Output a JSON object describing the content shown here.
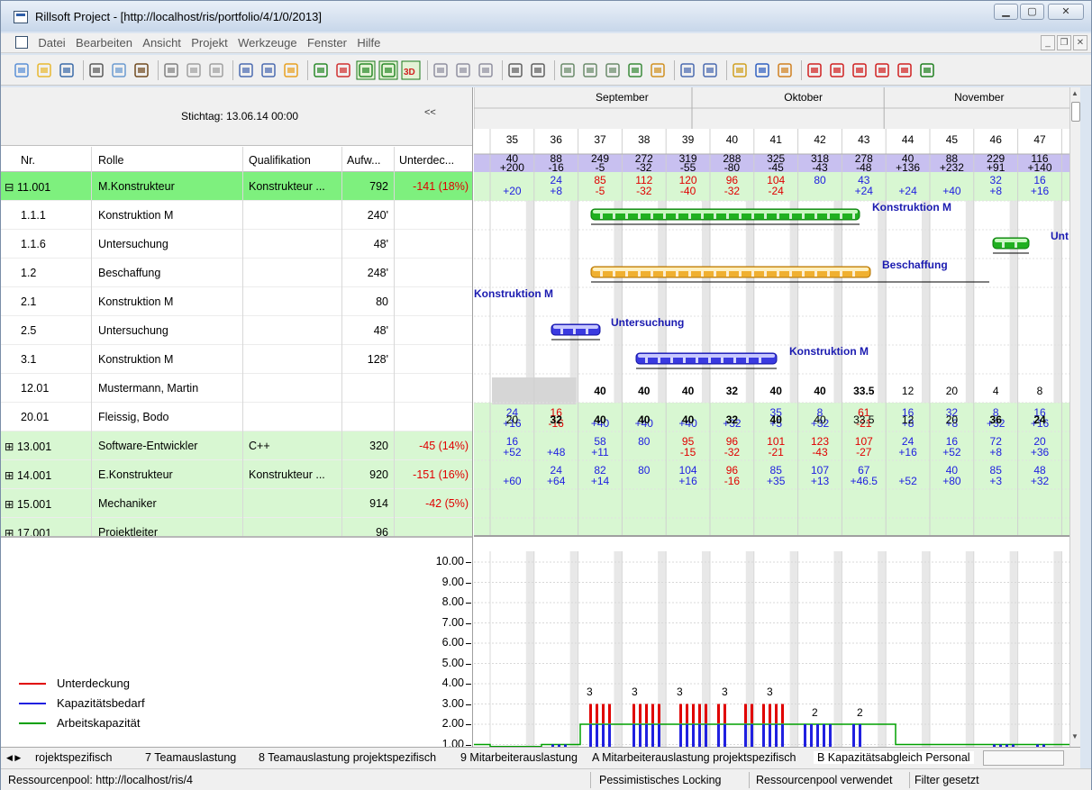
{
  "window": {
    "title": "Rillsoft Project - [http://localhost/ris/portfolio/4/1/0/2013]"
  },
  "menu": [
    "Datei",
    "Bearbeiten",
    "Ansicht",
    "Projekt",
    "Werkzeuge",
    "Fenster",
    "Hilfe"
  ],
  "toolbar": {
    "icons": [
      "new-icon",
      "open-icon",
      "save-icon",
      "print-icon",
      "print-preview-icon",
      "find-icon",
      "cut-icon",
      "copy-icon",
      "paste-icon",
      "undo-icon",
      "redo-icon",
      "star-icon",
      "link-icon",
      "unlink-icon",
      "gantt-icon",
      "table-icon",
      "3d-icon",
      "level1-icon",
      "level2-icon",
      "level3-icon",
      "move-up-icon",
      "move-down-icon",
      "resource-icon",
      "add-resource-icon",
      "remove-resource-icon",
      "assign-icon",
      "filter-icon",
      "zoom-in-icon",
      "zoom-out-icon",
      "layout1-icon",
      "layout2-icon",
      "export-icon",
      "split-icon",
      "merge-icon",
      "shift-right-icon",
      "shift-down-icon",
      "shift-left-icon",
      "milestone-icon"
    ],
    "threeD": "3D"
  },
  "left": {
    "stichtag": "Stichtag: 13.06.14 00:00",
    "collapse": "<<",
    "headers": [
      "Nr.",
      "Rolle",
      "Qualifikation",
      "Aufw...",
      "Unterdec..."
    ],
    "rows": [
      {
        "nr": "⊟ 11.001",
        "rolle": "M.Konstrukteur",
        "qual": "Konstrukteur ...",
        "aufw": "792",
        "unter": "-141 (18%)",
        "kind": "role-selected"
      },
      {
        "nr": "1.1.1",
        "rolle": "Konstruktion M",
        "qual": "",
        "aufw": "240'",
        "unter": "",
        "kind": "task"
      },
      {
        "nr": "1.1.6",
        "rolle": "Untersuchung",
        "qual": "",
        "aufw": "48'",
        "unter": "",
        "kind": "task"
      },
      {
        "nr": "1.2",
        "rolle": "Beschaffung",
        "qual": "",
        "aufw": "248'",
        "unter": "",
        "kind": "task"
      },
      {
        "nr": "2.1",
        "rolle": "Konstruktion M",
        "qual": "",
        "aufw": "80",
        "unter": "",
        "kind": "task"
      },
      {
        "nr": "2.5",
        "rolle": "Untersuchung",
        "qual": "",
        "aufw": "48'",
        "unter": "",
        "kind": "task"
      },
      {
        "nr": "3.1",
        "rolle": "Konstruktion M",
        "qual": "",
        "aufw": "128'",
        "unter": "",
        "kind": "task"
      },
      {
        "nr": "12.01",
        "rolle": "Mustermann, Martin",
        "qual": "",
        "aufw": "",
        "unter": "",
        "kind": "person"
      },
      {
        "nr": "20.01",
        "rolle": "Fleissig, Bodo",
        "qual": "",
        "aufw": "",
        "unter": "",
        "kind": "person"
      },
      {
        "nr": "⊞ 13.001",
        "rolle": "Software-Entwickler",
        "qual": "C++",
        "aufw": "320",
        "unter": "-45 (14%)",
        "kind": "role"
      },
      {
        "nr": "⊞ 14.001",
        "rolle": "E.Konstrukteur",
        "qual": "Konstrukteur ...",
        "aufw": "920",
        "unter": "-151 (16%)",
        "kind": "role"
      },
      {
        "nr": "⊞ 15.001",
        "rolle": "Mechaniker",
        "qual": "",
        "aufw": "914",
        "unter": "-42 (5%)",
        "kind": "role"
      },
      {
        "nr": "⊞ 17.001",
        "rolle": "Projektleiter",
        "qual": "",
        "aufw": "96",
        "unter": "",
        "kind": "role"
      }
    ],
    "legend": [
      {
        "label": "Unterdeckung",
        "color": "#e00000"
      },
      {
        "label": "Kapazitätsbedarf",
        "color": "#2020e0"
      },
      {
        "label": "Arbeitskapazität",
        "color": "#00a000"
      }
    ],
    "yticks": [
      "10.00",
      "9.00",
      "8.00",
      "7.00",
      "6.00",
      "5.00",
      "4.00",
      "3.00",
      "2.00",
      "1.00"
    ]
  },
  "timeline": {
    "months": [
      "September",
      "Oktober",
      "November"
    ],
    "weeks": [
      "35",
      "36",
      "37",
      "38",
      "39",
      "40",
      "41",
      "42",
      "43",
      "44",
      "45",
      "46",
      "47"
    ],
    "summary": [
      {
        "t": "40",
        "b": "+200"
      },
      {
        "t": "88",
        "b": "-16"
      },
      {
        "t": "249",
        "b": "-5"
      },
      {
        "t": "272",
        "b": "-32"
      },
      {
        "t": "319",
        "b": "-55"
      },
      {
        "t": "288",
        "b": "-80"
      },
      {
        "t": "325",
        "b": "-45"
      },
      {
        "t": "318",
        "b": "-43"
      },
      {
        "t": "278",
        "b": "-48"
      },
      {
        "t": "40",
        "b": "+136"
      },
      {
        "t": "88",
        "b": "+232"
      },
      {
        "t": "229",
        "b": "+91"
      },
      {
        "t": "116",
        "b": "+140"
      }
    ],
    "role_rows": [
      [
        {
          "t": "",
          "b": "+20"
        },
        {
          "t": "24",
          "b": "+8"
        },
        {
          "t": "85",
          "b": "-5"
        },
        {
          "t": "112",
          "b": "-32"
        },
        {
          "t": "120",
          "b": "-40"
        },
        {
          "t": "96",
          "b": "-32"
        },
        {
          "t": "104",
          "b": "-24"
        },
        {
          "t": "80",
          "b": ""
        },
        {
          "t": "43",
          "b": "+24"
        },
        {
          "t": "",
          "b": "+24"
        },
        {
          "t": "",
          "b": "+40"
        },
        {
          "t": "32",
          "b": "+8"
        },
        {
          "t": "16",
          "b": "+16"
        }
      ],
      [
        {
          "t": "24",
          "b": "+16"
        },
        {
          "t": "16",
          "b": "-16"
        },
        {
          "t": "",
          "b": "+40"
        },
        {
          "t": "",
          "b": "+40"
        },
        {
          "t": "",
          "b": "+40"
        },
        {
          "t": "",
          "b": "+32"
        },
        {
          "t": "35",
          "b": "+5"
        },
        {
          "t": "8",
          "b": "+32"
        },
        {
          "t": "61",
          "b": "-21"
        },
        {
          "t": "16",
          "b": "+8"
        },
        {
          "t": "32",
          "b": "+8"
        },
        {
          "t": "8",
          "b": "+32"
        },
        {
          "t": "16",
          "b": "+16"
        }
      ],
      [
        {
          "t": "16",
          "b": "+52"
        },
        {
          "t": "",
          "b": "+48"
        },
        {
          "t": "58",
          "b": "+11"
        },
        {
          "t": "80",
          "b": ""
        },
        {
          "t": "95",
          "b": "-15"
        },
        {
          "t": "96",
          "b": "-32"
        },
        {
          "t": "101",
          "b": "-21"
        },
        {
          "t": "123",
          "b": "-43"
        },
        {
          "t": "107",
          "b": "-27"
        },
        {
          "t": "24",
          "b": "+16"
        },
        {
          "t": "16",
          "b": "+52"
        },
        {
          "t": "72",
          "b": "+8"
        },
        {
          "t": "20",
          "b": "+36"
        }
      ],
      [
        {
          "t": "",
          "b": "+60"
        },
        {
          "t": "24",
          "b": "+64"
        },
        {
          "t": "82",
          "b": "+14"
        },
        {
          "t": "80",
          "b": ""
        },
        {
          "t": "104",
          "b": "+16"
        },
        {
          "t": "96",
          "b": "-16"
        },
        {
          "t": "85",
          "b": "+35"
        },
        {
          "t": "107",
          "b": "+13"
        },
        {
          "t": "67",
          "b": "+46.5"
        },
        {
          "t": "",
          "b": "+52"
        },
        {
          "t": "40",
          "b": "+80"
        },
        {
          "t": "85",
          "b": "+3"
        },
        {
          "t": "48",
          "b": "+32"
        }
      ]
    ],
    "mustermann": [
      "",
      "",
      "40",
      "40",
      "40",
      "32",
      "40",
      "40",
      "33.5",
      "12",
      "20",
      "4",
      "8"
    ],
    "fleissig": [
      "20",
      "32",
      "40",
      "40",
      "40",
      "32",
      "40",
      "40",
      "33.5",
      "12",
      "20",
      "36",
      "24"
    ],
    "bars": [
      {
        "label": "Konstruktion M",
        "color": "green"
      },
      {
        "label": "Unt",
        "color": "green"
      },
      {
        "label": "Beschaffung",
        "color": "orange"
      },
      {
        "label": "Konstruktion M",
        "color": "none"
      },
      {
        "label": "Untersuchung",
        "color": "blue"
      },
      {
        "label": "Konstruktion M",
        "color": "blue"
      }
    ],
    "histogram_peaks": [
      "1",
      "3",
      "3",
      "3",
      "3",
      "3",
      "2",
      "2",
      "1",
      "1"
    ]
  },
  "tabs": [
    "rojektspezifisch",
    "7 Teamauslastung",
    "8 Teamauslastung projektspezifisch",
    "9 Mitarbeiterauslastung",
    "A Mitarbeiterauslastung projektspezifisch",
    "B Kapazitätsabgleich Personal"
  ],
  "status": [
    "Ressourcenpool: http://localhost/ris/4",
    "Pessimistisches Locking",
    "Ressourcenpool verwendet",
    "Filter gesetzt"
  ]
}
